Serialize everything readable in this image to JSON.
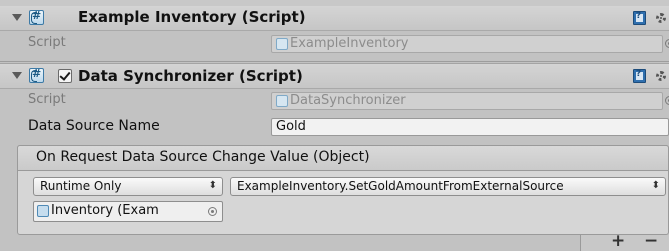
{
  "components": [
    {
      "title": "Example Inventory (Script)",
      "script_label": "Script",
      "script_value": "ExampleInventory"
    },
    {
      "title": "Data Synchronizer (Script)",
      "enabled": true,
      "script_label": "Script",
      "script_value": "DataSynchronizer",
      "data_source_name_label": "Data Source Name",
      "data_source_name_value": "Gold",
      "event": {
        "header": "On Request Data Source Change Value (Object)",
        "call_state": "Runtime Only",
        "function": "ExampleInventory.SetGoldAmountFromExternalSource",
        "target_object": "Inventory (Exam"
      }
    }
  ],
  "footer": {
    "add": "+",
    "remove": "−"
  },
  "icons": {
    "foldout": "triangle-down-icon",
    "script": "csharp-script-icon",
    "help": "book-help-icon",
    "settings": "gear-icon",
    "object_picker": "object-picker-icon",
    "dropdown": "dropdown-arrows-icon"
  },
  "colors": {
    "background": "#c2c2c2",
    "header": "#cdcdcd",
    "field_disabled": "#d0d0d0"
  }
}
